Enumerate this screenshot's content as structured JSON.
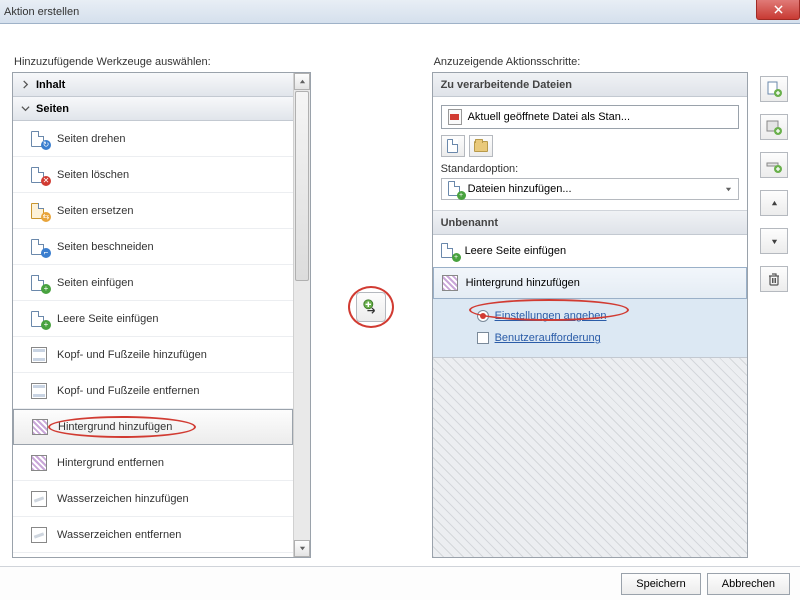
{
  "window": {
    "title": "Aktion erstellen"
  },
  "left": {
    "label": "Hinzuzufügende Werkzeuge auswählen:",
    "categories": {
      "content": "Inhalt",
      "pages": "Seiten"
    },
    "tools": {
      "rotate": "Seiten drehen",
      "delete": "Seiten löschen",
      "replace": "Seiten ersetzen",
      "crop": "Seiten beschneiden",
      "insert": "Seiten einfügen",
      "insert_blank": "Leere Seite einfügen",
      "hf_add": "Kopf- und Fußzeile hinzufügen",
      "hf_remove": "Kopf- und Fußzeile entfernen",
      "bg_add": "Hintergrund hinzufügen",
      "bg_remove": "Hintergrund entfernen",
      "wm_add": "Wasserzeichen hinzufügen",
      "wm_remove": "Wasserzeichen entfernen"
    }
  },
  "right": {
    "label": "Anzuzeigende Aktionsschritte:",
    "files_header": "Zu verarbeitende Dateien",
    "file_entry": "Aktuell geöffnete Datei als Stan...",
    "std_option_label": "Standardoption:",
    "dropdown": "Dateien hinzufügen...",
    "group_header": "Unbenannt",
    "steps": {
      "insert_blank": "Leere Seite einfügen",
      "bg_add": "Hintergrund hinzufügen"
    },
    "options": {
      "settings": "Einstellungen angeben",
      "prompt": "Benutzeraufforderung"
    }
  },
  "footer": {
    "save": "Speichern",
    "cancel": "Abbrechen"
  }
}
